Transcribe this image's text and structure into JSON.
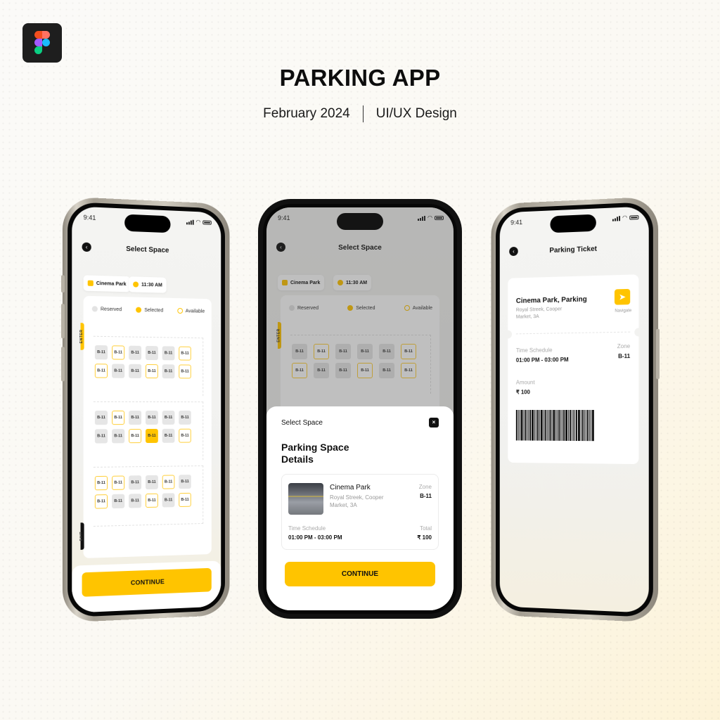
{
  "header": {
    "title": "PARKING APP",
    "date": "February 2024",
    "category": "UI/UX Design",
    "logo_icon": "figma-logo-icon"
  },
  "colors": {
    "accent": "#ffc400",
    "reserved": "#e6e6e6",
    "dark": "#111111"
  },
  "status_bar": {
    "time": "9:41"
  },
  "select_space": {
    "title": "Select Space",
    "location_chip": "Cinema Park",
    "time_chip": "11:30 AM",
    "legend": [
      "Reserved",
      "Selected",
      "Available"
    ],
    "enter_label": "ENTER",
    "exit_label": "EXIT",
    "slot_label": "B-11",
    "zones": [
      [
        "reserved",
        "available",
        "reserved",
        "reserved",
        "reserved",
        "available",
        "available",
        "reserved",
        "reserved",
        "available",
        "reserved",
        "available"
      ],
      [
        "reserved",
        "available",
        "reserved",
        "reserved",
        "reserved",
        "reserved",
        "reserved",
        "reserved",
        "available",
        "selected",
        "reserved",
        "available"
      ],
      [
        "available",
        "available",
        "reserved",
        "reserved",
        "available",
        "reserved",
        "available",
        "reserved",
        "reserved",
        "available",
        "reserved",
        "available"
      ]
    ],
    "continue_label": "CONTINUE"
  },
  "details_modal": {
    "header": "Select Space",
    "title": "Parking Space Details",
    "name": "Cinema Park",
    "address": "Royal Streek, Cooper Market, 3A",
    "zone_label": "Zone",
    "zone_value": "B-11",
    "time_label": "Time Schedule",
    "time_value": "01:00 PM - 03:00 PM",
    "total_label": "Total",
    "total_value": "₹ 100",
    "continue_label": "CONTINUE"
  },
  "ticket": {
    "title": "Parking Ticket",
    "name": "Cinema Park, Parking",
    "address": "Royal Streek, Cooper Market, 3A",
    "navigate_label": "Navigate",
    "time_label": "Time Schedule",
    "time_value": "01:00 PM - 03:00 PM",
    "zone_label": "Zone",
    "zone_value": "B-11",
    "amount_label": "Amount",
    "amount_value": "₹ 100"
  }
}
